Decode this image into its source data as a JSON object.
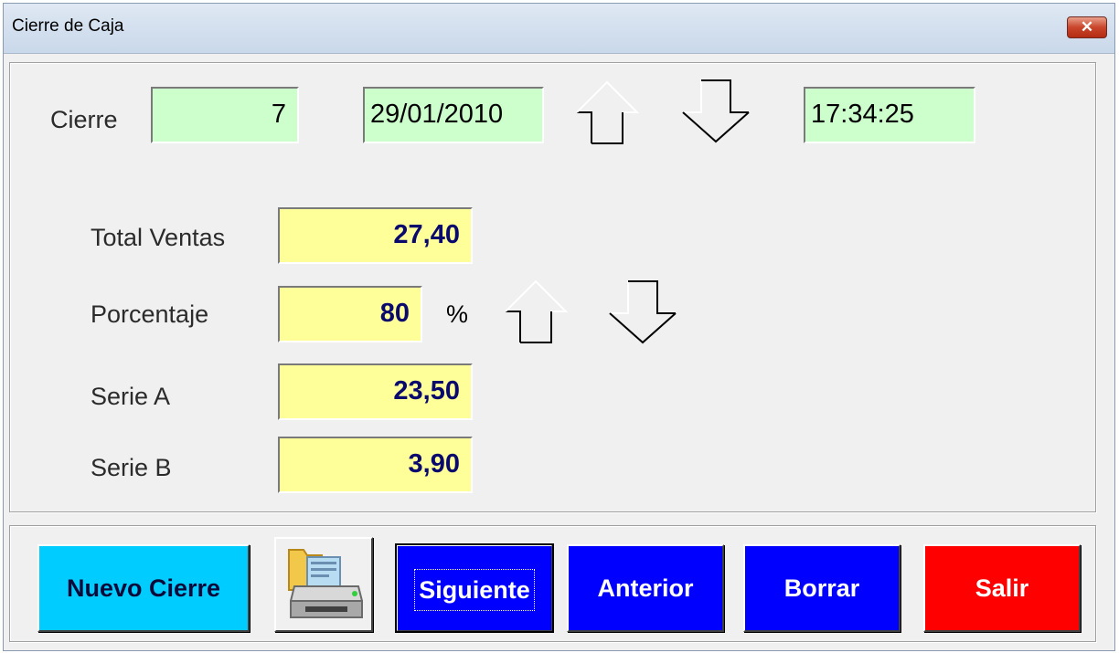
{
  "window": {
    "title": "Cierre de Caja",
    "close_glyph": "✕"
  },
  "header": {
    "cierre_label": "Cierre",
    "cierre_number": "7",
    "date": "29/01/2010",
    "time": "17:34:25"
  },
  "totals": {
    "total_ventas_label": "Total Ventas",
    "total_ventas_value": "27,40",
    "porcentaje_label": "Porcentaje",
    "porcentaje_value": "80",
    "percent_sign": "%",
    "serie_a_label": "Serie A",
    "serie_a_value": "23,50",
    "serie_b_label": "Serie B",
    "serie_b_value": "3,90"
  },
  "toolbar": {
    "nuevo_cierre": "Nuevo Cierre",
    "siguiente": "Siguiente",
    "anterior": "Anterior",
    "borrar": "Borrar",
    "salir": "Salir"
  },
  "colors": {
    "green_field": "#ccffcc",
    "yellow_field": "#ffff99",
    "value_text": "#0a0a6e",
    "nuevo_button": "#00ccff",
    "blue_button": "#0000ff",
    "salir_button": "#ff0000"
  },
  "icons": {
    "up_arrow": "arrow-up-icon",
    "down_arrow": "arrow-down-icon",
    "printer": "printer-icon"
  }
}
